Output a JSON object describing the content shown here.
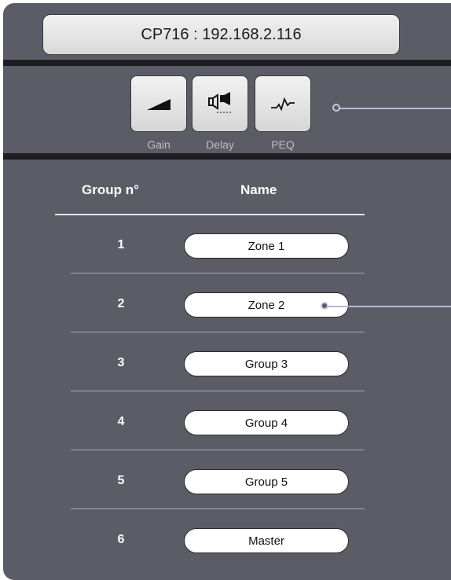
{
  "device_title": "CP716 : 192.168.2.116",
  "tools": {
    "gain": {
      "label": "Gain",
      "icon": "gain-ramp-icon"
    },
    "delay": {
      "label": "Delay",
      "icon": "delay-speakers-icon"
    },
    "peq": {
      "label": "PEQ",
      "icon": "peq-curve-icon"
    }
  },
  "table": {
    "headers": {
      "group": "Group n°",
      "name": "Name"
    },
    "rows": [
      {
        "number": "1",
        "name": "Zone 1"
      },
      {
        "number": "2",
        "name": "Zone 2"
      },
      {
        "number": "3",
        "name": "Group 3"
      },
      {
        "number": "4",
        "name": "Group 4"
      },
      {
        "number": "5",
        "name": "Group 5"
      },
      {
        "number": "6",
        "name": "Master"
      }
    ]
  },
  "colors": {
    "panel": "#5c5c66",
    "connector": "#b8b8d8",
    "divider": "#1e1e22"
  }
}
